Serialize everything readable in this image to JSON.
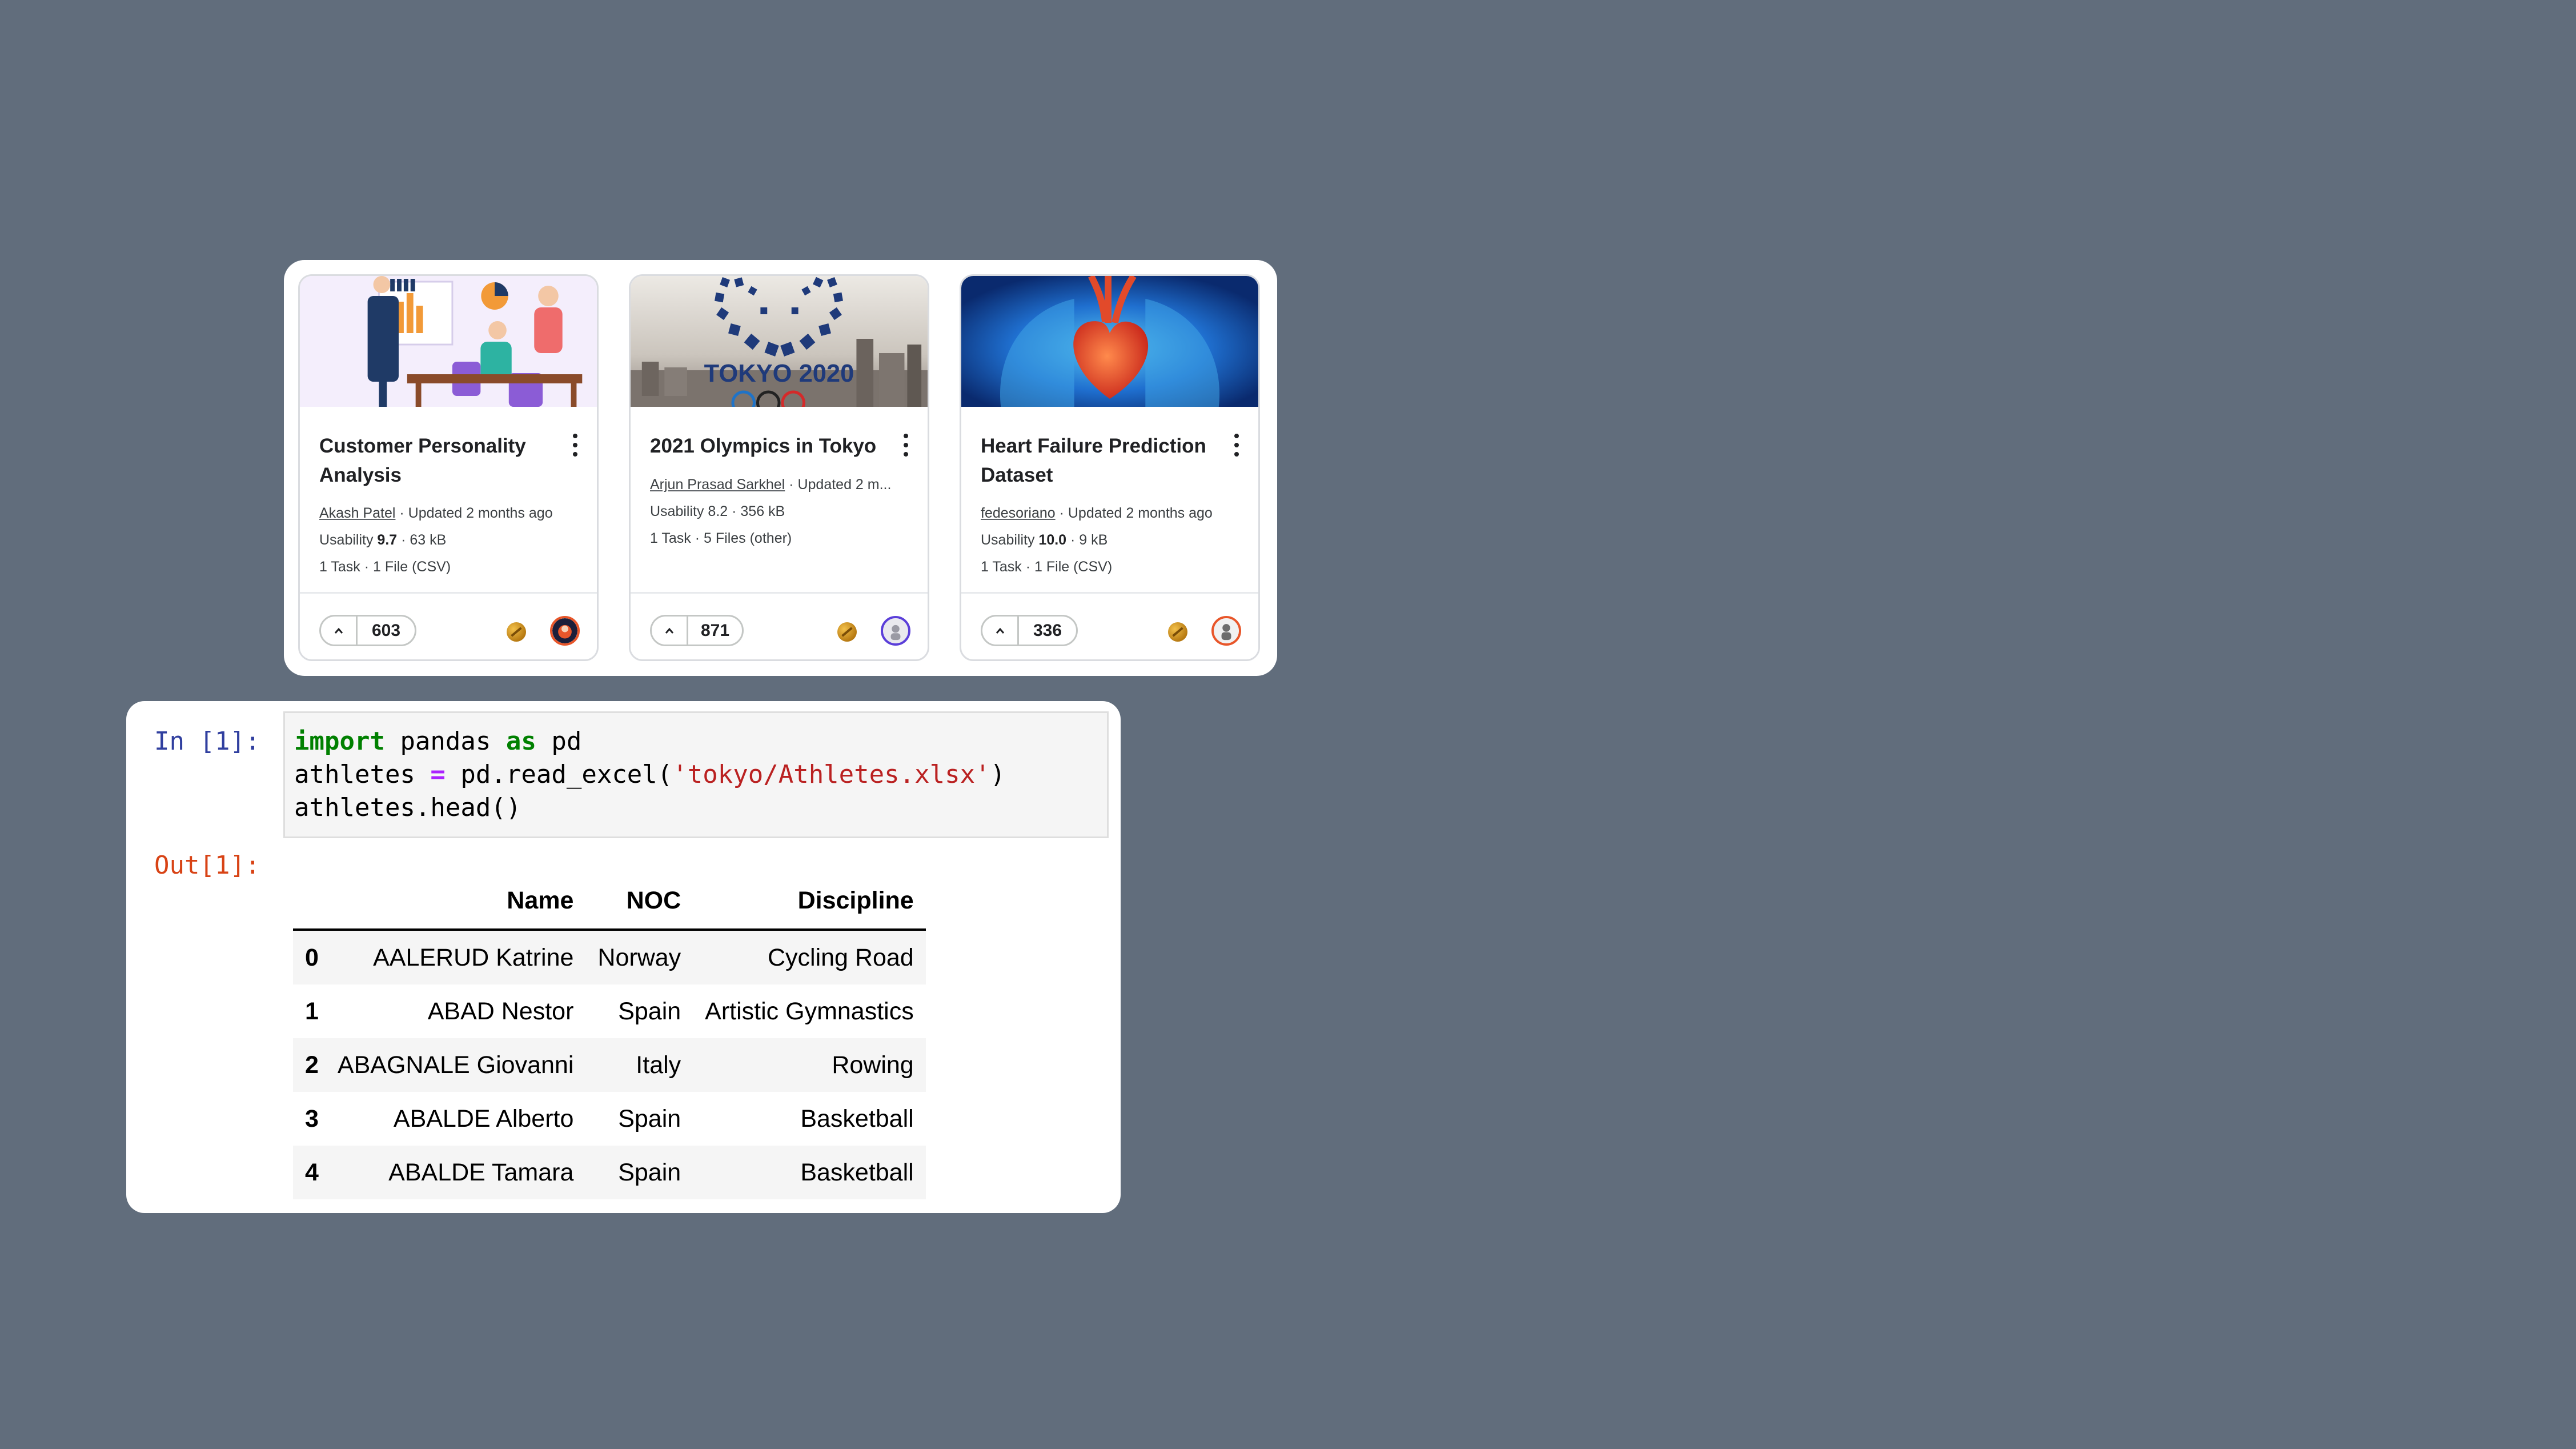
{
  "cards": [
    {
      "title_line1": "Customer Personality",
      "title_line2": "Analysis",
      "author": "Akash Patel",
      "updated": " · Updated 2 months ago",
      "usability_label": "Usability ",
      "usability": "9.7",
      "size": " · 63 kB",
      "files": "1 Task · 1 File (CSV)",
      "votes": "603"
    },
    {
      "title_line1": "2021 Olympics in Tokyo",
      "author": "Arjun Prasad Sarkhel",
      "updated": " · Updated 2 m...",
      "usability_text": "Usability 8.2 · 356 kB",
      "files": "5 Files (other)",
      "files_prefix": "1 Task · ",
      "votes": "871",
      "thumb_text": "TOKYO 2020"
    },
    {
      "title_line1": "Heart Failure Prediction",
      "title_line2": "Dataset",
      "author": "fedesoriano",
      "updated": " · Updated 2 months ago",
      "usability_label": "Usability ",
      "usability": "10.0",
      "size": " · 9 kB",
      "files": "1 Task · 1 File (CSV)",
      "votes": "336"
    }
  ],
  "notebook": {
    "in_prompt": "In [1]:",
    "out_prompt": "Out[1]:",
    "code": {
      "l1_kw1": "import",
      "l1_mid": " pandas ",
      "l1_kw2": "as",
      "l1_end": " pd",
      "l2_a": "athletes ",
      "l2_op": "=",
      "l2_b": " pd.read_excel(",
      "l2_str": "'tokyo/Athletes.xlsx'",
      "l2_c": ")",
      "l3": "athletes.head()"
    },
    "table": {
      "columns": [
        "Name",
        "NOC",
        "Discipline"
      ],
      "rows": [
        {
          "index": "0",
          "name": "AALERUD Katrine",
          "noc": "Norway",
          "discipline": "Cycling Road"
        },
        {
          "index": "1",
          "name": "ABAD Nestor",
          "noc": "Spain",
          "discipline": "Artistic Gymnastics"
        },
        {
          "index": "2",
          "name": "ABAGNALE Giovanni",
          "noc": "Italy",
          "discipline": "Rowing"
        },
        {
          "index": "3",
          "name": "ABALDE Alberto",
          "noc": "Spain",
          "discipline": "Basketball"
        },
        {
          "index": "4",
          "name": "ABALDE Tamara",
          "noc": "Spain",
          "discipline": "Basketball"
        }
      ]
    }
  },
  "colors": {
    "background": "#616d7c",
    "keyword": "#008000",
    "string": "#ba2121",
    "operator": "#aa22ff",
    "in_prompt": "#303f9f",
    "out_prompt": "#d84315"
  }
}
